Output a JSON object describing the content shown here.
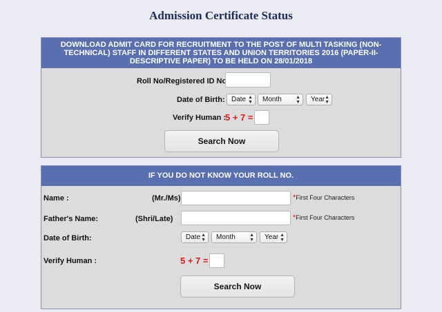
{
  "page": {
    "title": "Admission Certificate Status"
  },
  "section1": {
    "header": "DOWNLOAD ADMIT CARD FOR RECRUITMENT TO THE POST OF MULTI TASKING (NON-TECHNICAL) STAFF IN DIFFERENT STATES AND UNION TERRITORIES 2016 (PAPER-II-DESCRIPTIVE PAPER) TO BE HELD ON 28/01/2018",
    "roll_label": "Roll No/Registered ID No :",
    "roll_value": "",
    "dob_label": "Date of Birth:",
    "dob": {
      "day": "Date",
      "month": "Month",
      "year": "Year"
    },
    "verify_label": "Verify Human :",
    "captcha": "5 + 7 =",
    "captcha_answer": "",
    "search_label": "Search Now"
  },
  "section2": {
    "header": "IF YOU DO NOT KNOW YOUR ROLL NO.",
    "name_label": "Name :",
    "name_prefix": "(Mr./Ms)",
    "name_value": "",
    "name_hint": "First Four Characters",
    "father_label": "Father's Name:",
    "father_prefix": "(Shri/Late)",
    "father_value": "",
    "father_hint": "First Four Characters",
    "dob_label": "Date of Birth:",
    "dob": {
      "day": "Date",
      "month": "Month",
      "year": "Year"
    },
    "verify_label": "Verify Human :",
    "captcha": "5 + 7 =",
    "captcha_answer": "",
    "search_label": "Search Now",
    "required_mark": "*"
  },
  "icons": {
    "select_arrow": "updown-arrows-icon"
  },
  "colors": {
    "header_bg": "#5a6fb0",
    "panel_bg": "#dcdcdc",
    "captcha": "#e21414",
    "title": "#1c2a5c"
  }
}
